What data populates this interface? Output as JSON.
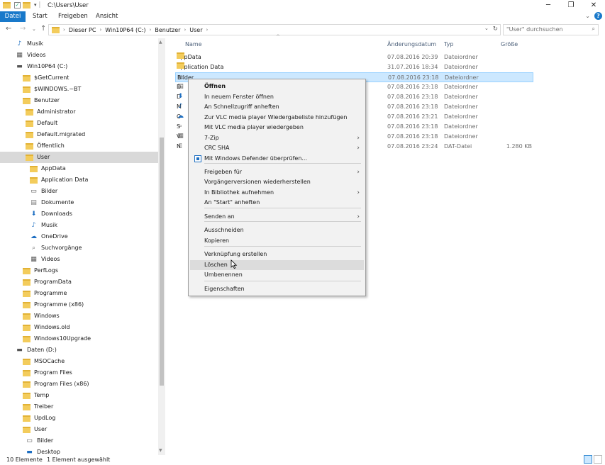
{
  "window": {
    "title": "C:\\Users\\User",
    "controls": {
      "minimize": "─",
      "maximize": "❐",
      "close": "✕"
    }
  },
  "ribbon": {
    "tabs": [
      "Datei",
      "Start",
      "Freigeben",
      "Ansicht"
    ],
    "help": "?"
  },
  "address": {
    "crumbs": [
      "Dieser PC",
      "Win10P64 (C:)",
      "Benutzer",
      "User"
    ],
    "search_placeholder": "\"User\" durchsuchen"
  },
  "nav_pane": {
    "items": [
      {
        "label": "Musik",
        "icon": "music-icon"
      },
      {
        "label": "Videos",
        "icon": "video-icon"
      },
      {
        "label": "Win10P64 (C:)",
        "icon": "drive-icon"
      },
      {
        "label": "$GetCurrent",
        "icon": "folder-icon"
      },
      {
        "label": "$WINDOWS.~BT",
        "icon": "folder-icon"
      },
      {
        "label": "Benutzer",
        "icon": "folder-icon"
      },
      {
        "label": "Administrator",
        "icon": "folder-icon"
      },
      {
        "label": "Default",
        "icon": "folder-icon"
      },
      {
        "label": "Default.migrated",
        "icon": "folder-icon"
      },
      {
        "label": "Öffentlich",
        "icon": "folder-icon"
      },
      {
        "label": "User",
        "icon": "folder-icon",
        "selected": true
      },
      {
        "label": "AppData",
        "icon": "folder-icon"
      },
      {
        "label": "Application Data",
        "icon": "folder-icon"
      },
      {
        "label": "Bilder",
        "icon": "pictures-icon"
      },
      {
        "label": "Dokumente",
        "icon": "documents-icon"
      },
      {
        "label": "Downloads",
        "icon": "download-icon"
      },
      {
        "label": "Musik",
        "icon": "music-icon"
      },
      {
        "label": "OneDrive",
        "icon": "cloud-icon"
      },
      {
        "label": "Suchvorgänge",
        "icon": "search-icon"
      },
      {
        "label": "Videos",
        "icon": "video-icon"
      },
      {
        "label": "PerfLogs",
        "icon": "folder-icon"
      },
      {
        "label": "ProgramData",
        "icon": "folder-icon"
      },
      {
        "label": "Programme",
        "icon": "folder-icon"
      },
      {
        "label": "Programme (x86)",
        "icon": "folder-icon"
      },
      {
        "label": "Windows",
        "icon": "folder-icon"
      },
      {
        "label": "Windows.old",
        "icon": "folder-icon"
      },
      {
        "label": "Windows10Upgrade",
        "icon": "folder-icon"
      },
      {
        "label": "Daten (D:)",
        "icon": "drive-icon"
      },
      {
        "label": "MSOCache",
        "icon": "folder-icon"
      },
      {
        "label": "Program Files",
        "icon": "folder-icon"
      },
      {
        "label": "Program Files (x86)",
        "icon": "folder-icon"
      },
      {
        "label": "Temp",
        "icon": "folder-icon"
      },
      {
        "label": "Treiber",
        "icon": "folder-icon"
      },
      {
        "label": "UpdLog",
        "icon": "folder-icon"
      },
      {
        "label": "User",
        "icon": "folder-icon"
      },
      {
        "label": "Bilder",
        "icon": "pictures-icon"
      },
      {
        "label": "Desktop",
        "icon": "desktop-icon"
      }
    ]
  },
  "file_list": {
    "columns": {
      "name": "Name",
      "date": "Änderungsdatum",
      "type": "Typ",
      "size": "Größe"
    },
    "rows": [
      {
        "name": "AppData",
        "date": "07.08.2016 20:39",
        "type": "Dateiordner",
        "size": "",
        "icon": "folder-icon"
      },
      {
        "name": "Application Data",
        "date": "31.07.2016 18:34",
        "type": "Dateiordner",
        "size": "",
        "icon": "folder-icon"
      },
      {
        "name": "Bilder",
        "date": "07.08.2016 23:18",
        "type": "Dateiordner",
        "size": "",
        "icon": "pictures-icon",
        "selected": true
      },
      {
        "name": "D",
        "date": "07.08.2016 23:18",
        "type": "Dateiordner",
        "size": "",
        "icon": "documents-icon"
      },
      {
        "name": "D",
        "date": "07.08.2016 23:18",
        "type": "Dateiordner",
        "size": "",
        "icon": "download-icon"
      },
      {
        "name": "M",
        "date": "07.08.2016 23:18",
        "type": "Dateiordner",
        "size": "",
        "icon": "music-icon"
      },
      {
        "name": "O",
        "date": "07.08.2016 23:21",
        "type": "Dateiordner",
        "size": "",
        "icon": "cloud-icon"
      },
      {
        "name": "S",
        "date": "07.08.2016 23:18",
        "type": "Dateiordner",
        "size": "",
        "icon": "search-icon"
      },
      {
        "name": "V",
        "date": "07.08.2016 23:18",
        "type": "Dateiordner",
        "size": "",
        "icon": "video-icon"
      },
      {
        "name": "N",
        "date": "07.08.2016 23:24",
        "type": "DAT-Datei",
        "size": "1.280 KB",
        "icon": "file-icon"
      }
    ]
  },
  "context_menu": {
    "items": [
      {
        "label": "Öffnen",
        "bold": true
      },
      {
        "label": "In neuem Fenster öffnen"
      },
      {
        "label": "An Schnellzugriff anheften"
      },
      {
        "label": "Zur VLC media player Wiedergabeliste hinzufügen"
      },
      {
        "label": "Mit VLC media player wiedergeben"
      },
      {
        "label": "7-Zip",
        "submenu": true
      },
      {
        "label": "CRC SHA",
        "submenu": true
      },
      {
        "label": "Mit Windows Defender überprüfen...",
        "icon": "defender-icon"
      },
      {
        "label": "Freigeben für",
        "submenu": true
      },
      {
        "label": "Vorgängerversionen wiederherstellen"
      },
      {
        "label": "In Bibliothek aufnehmen",
        "submenu": true
      },
      {
        "label": "An \"Start\" anheften"
      },
      {
        "label": "Senden an",
        "submenu": true
      },
      {
        "label": "Ausschneiden"
      },
      {
        "label": "Kopieren"
      },
      {
        "label": "Verknüpfung erstellen"
      },
      {
        "label": "Löschen",
        "hover": true
      },
      {
        "label": "Umbenennen"
      },
      {
        "label": "Eigenschaften"
      }
    ]
  },
  "status_bar": {
    "count": "10 Elemente",
    "selection": "1 Element ausgewählt"
  },
  "colors": {
    "accent": "#1979ca",
    "selection": "#cce8ff",
    "folder": "#f3cc5c"
  }
}
